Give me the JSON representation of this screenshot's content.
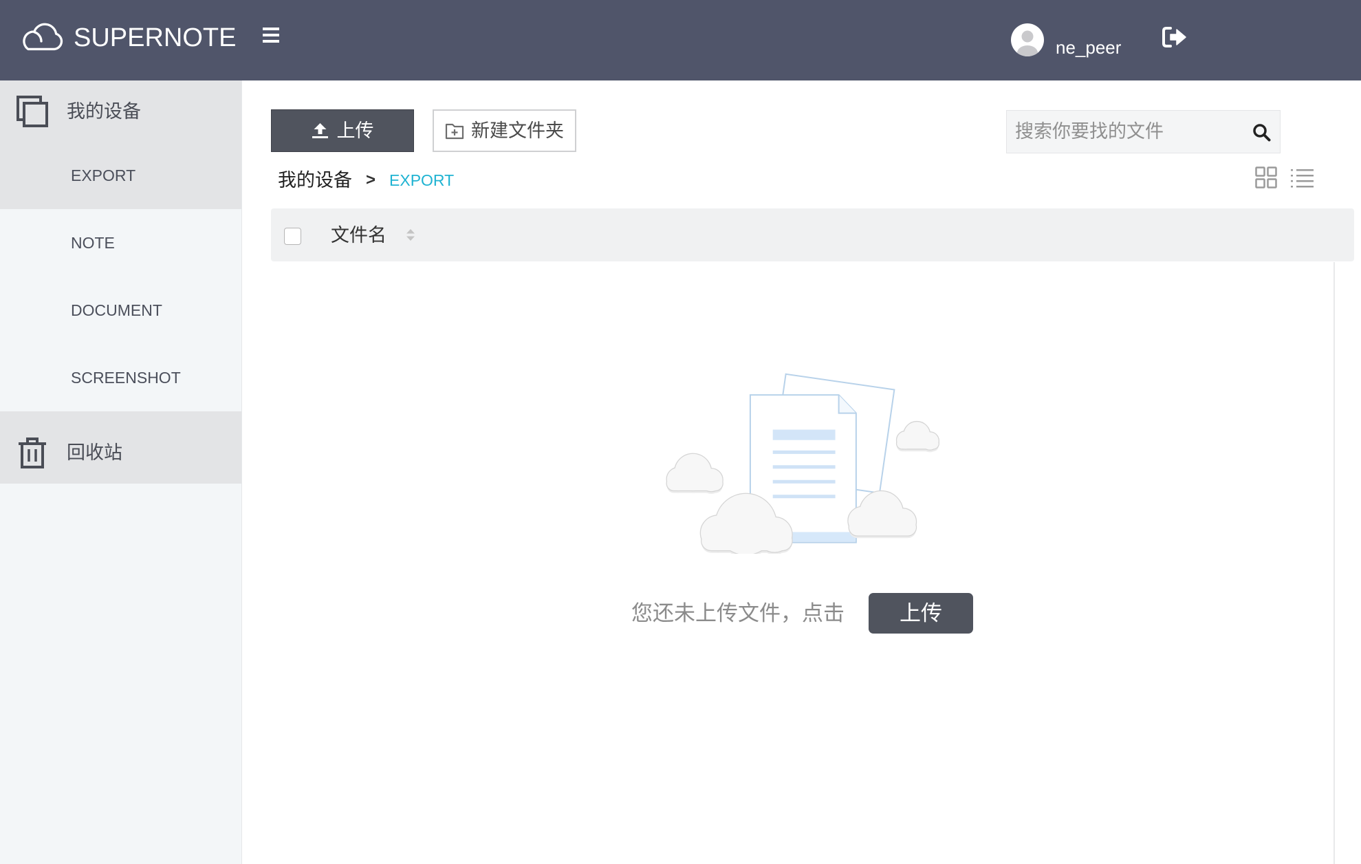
{
  "header": {
    "logo_text": "SUPERNOTE",
    "username": "ne_peer",
    "icons": {
      "logo": "cloud-logo-icon",
      "menu": "hamburger-menu-icon",
      "avatar": "user-avatar-icon",
      "logout": "logout-icon"
    }
  },
  "sidebar": {
    "devices": {
      "label": "我的设备",
      "icon": "device-icon",
      "items": [
        {
          "label": "EXPORT",
          "active": true
        },
        {
          "label": "NOTE",
          "active": false
        },
        {
          "label": "DOCUMENT",
          "active": false
        },
        {
          "label": "SCREENSHOT",
          "active": false
        }
      ]
    },
    "trash": {
      "label": "回收站",
      "icon": "trash-icon"
    }
  },
  "toolbar": {
    "upload_label": "上传",
    "upload_icon": "upload-icon",
    "new_folder_label": "新建文件夹",
    "new_folder_icon": "folder-plus-icon",
    "search_placeholder": "搜索你要找的文件",
    "search_value": "",
    "search_icon": "search-icon",
    "view_icons": [
      "grid-view-icon",
      "list-view-icon"
    ]
  },
  "breadcrumb": {
    "items": [
      "我的设备",
      "EXPORT"
    ],
    "separator": ">"
  },
  "file_table": {
    "select_all_checked": false,
    "columns": [
      {
        "label": "文件名",
        "sortable": true
      }
    ],
    "rows": []
  },
  "empty_state": {
    "illustration": "empty-files-illustration",
    "message": "您还未上传文件，点击",
    "upload_label": "上传"
  },
  "colors": {
    "header_bg": "#50556a",
    "sidebar_bg": "#f3f6f8",
    "sidebar_active_bg": "#e3e4e6",
    "primary_button_bg": "#50545e",
    "link_accent": "#1fb3d2",
    "table_header_bg": "#f0f1f2"
  }
}
